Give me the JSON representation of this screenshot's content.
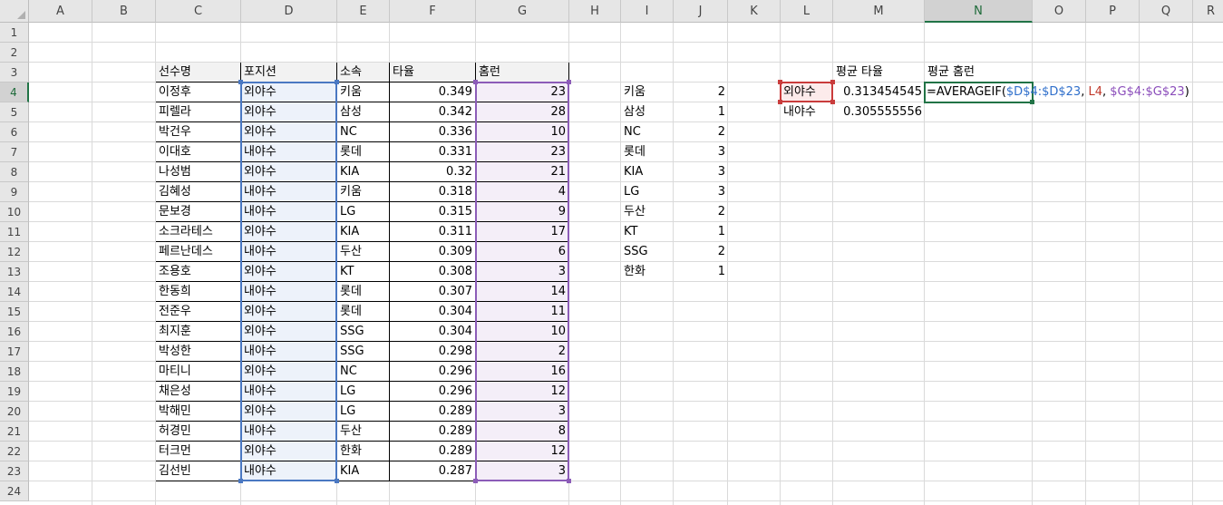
{
  "columns": [
    "A",
    "B",
    "C",
    "D",
    "E",
    "F",
    "G",
    "H",
    "I",
    "J",
    "K",
    "L",
    "M",
    "N",
    "O",
    "P",
    "Q",
    "R"
  ],
  "rows": [
    "1",
    "2",
    "3",
    "4",
    "5",
    "6",
    "7",
    "8",
    "9",
    "10",
    "11",
    "12",
    "13",
    "14",
    "15",
    "16",
    "17",
    "18",
    "19",
    "20",
    "21",
    "22",
    "23",
    "24"
  ],
  "active_column": "N",
  "active_row": "4",
  "table": {
    "headers": [
      "선수명",
      "포지션",
      "소속",
      "타율",
      "홈런"
    ],
    "rows": [
      [
        "이정후",
        "외야수",
        "키움",
        "0.349",
        "23"
      ],
      [
        "피렐라",
        "외야수",
        "삼성",
        "0.342",
        "28"
      ],
      [
        "박건우",
        "외야수",
        "NC",
        "0.336",
        "10"
      ],
      [
        "이대호",
        "내야수",
        "롯데",
        "0.331",
        "23"
      ],
      [
        "나성범",
        "외야수",
        "KIA",
        "0.32",
        "21"
      ],
      [
        "김혜성",
        "내야수",
        "키움",
        "0.318",
        "4"
      ],
      [
        "문보경",
        "내야수",
        "LG",
        "0.315",
        "9"
      ],
      [
        "소크라테스",
        "외야수",
        "KIA",
        "0.311",
        "17"
      ],
      [
        "페르난데스",
        "내야수",
        "두산",
        "0.309",
        "6"
      ],
      [
        "조용호",
        "외야수",
        "KT",
        "0.308",
        "3"
      ],
      [
        "한동희",
        "내야수",
        "롯데",
        "0.307",
        "14"
      ],
      [
        "전준우",
        "외야수",
        "롯데",
        "0.304",
        "11"
      ],
      [
        "최지훈",
        "외야수",
        "SSG",
        "0.304",
        "10"
      ],
      [
        "박성한",
        "내야수",
        "SSG",
        "0.298",
        "2"
      ],
      [
        "마티니",
        "외야수",
        "NC",
        "0.296",
        "16"
      ],
      [
        "채은성",
        "내야수",
        "LG",
        "0.296",
        "12"
      ],
      [
        "박해민",
        "외야수",
        "LG",
        "0.289",
        "3"
      ],
      [
        "허경민",
        "내야수",
        "두산",
        "0.289",
        "8"
      ],
      [
        "터크먼",
        "외야수",
        "한화",
        "0.289",
        "12"
      ],
      [
        "김선빈",
        "내야수",
        "KIA",
        "0.287",
        "3"
      ]
    ]
  },
  "team_counts": [
    [
      "키움",
      "2"
    ],
    [
      "삼성",
      "1"
    ],
    [
      "NC",
      "2"
    ],
    [
      "롯데",
      "3"
    ],
    [
      "KIA",
      "3"
    ],
    [
      "LG",
      "3"
    ],
    [
      "두산",
      "2"
    ],
    [
      "KT",
      "1"
    ],
    [
      "SSG",
      "2"
    ],
    [
      "한화",
      "1"
    ]
  ],
  "summary": {
    "header_avg": "평균 타율",
    "header_hr": "평균 홈런",
    "rows": [
      {
        "label": "외야수",
        "avg": "0.313454545"
      },
      {
        "label": "내야수",
        "avg": "0.305555556"
      }
    ]
  },
  "formula": {
    "prefix": "=AVERAGEIF(",
    "range1": "$D$4:$D$23",
    "sep1": ", ",
    "criteria": "L4",
    "sep2": ", ",
    "range2": "$G$4:$G$23",
    "suffix": ")"
  },
  "colors": {
    "range_blue": "#4a78c2",
    "range_red": "#c93c3c",
    "range_purple": "#8c5cb8",
    "active_green": "#217346"
  }
}
